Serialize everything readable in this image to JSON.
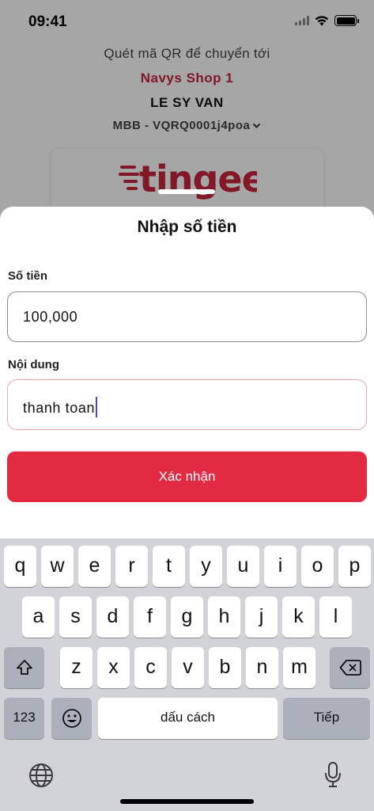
{
  "status_bar": {
    "time": "09:41",
    "icons": [
      "cellular-signal-icon",
      "wifi-icon",
      "battery-icon"
    ]
  },
  "background": {
    "qr_caption": "Quét mã QR để chuyển tới",
    "shop_name": "Navys Shop 1",
    "account_name": "LE SY VAN",
    "account_select": "MBB - VQRQ0001j4poa",
    "logo_text": "tingee"
  },
  "sheet": {
    "title": "Nhập số tiền",
    "amount_label": "Số tiền",
    "amount_value": "100,000",
    "content_label": "Nội dung",
    "content_value": "thanh toan",
    "confirm_label": "Xác nhận"
  },
  "keyboard": {
    "row1": [
      "q",
      "w",
      "e",
      "r",
      "t",
      "y",
      "u",
      "i",
      "o",
      "p"
    ],
    "row2": [
      "a",
      "s",
      "d",
      "f",
      "g",
      "h",
      "j",
      "k",
      "l"
    ],
    "row3": [
      "z",
      "x",
      "c",
      "v",
      "b",
      "n",
      "m"
    ],
    "numbers_label": "123",
    "space_label": "dấu cách",
    "next_label": "Tiếp"
  },
  "colors": {
    "accent": "#e32a43",
    "brand": "#c8243b",
    "caret": "#5b3fd0",
    "keyboard_bg": "#d1d3d9"
  }
}
